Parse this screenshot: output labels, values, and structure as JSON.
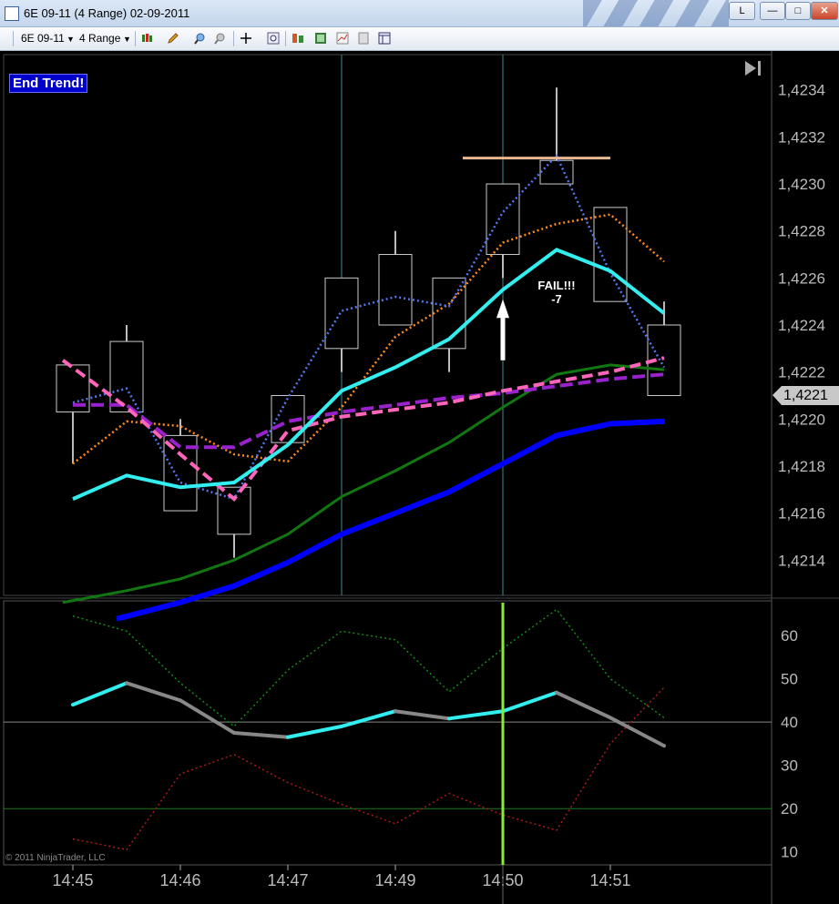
{
  "window": {
    "title": "6E 09-11 (4 Range)  02-09-2011",
    "buttons": {
      "l": "L",
      "minimize": "—",
      "maximize": "□",
      "close": "✕"
    }
  },
  "toolbar": {
    "instrument": "6E 09-11",
    "interval": "4 Range",
    "icons": [
      "candlestick-style-icon",
      "pencil-draw-icon",
      "zoom-in-icon",
      "zoom-out-icon",
      "crosshair-icon",
      "magnify-icon",
      "data-box-icon",
      "chart-trader-icon",
      "strategy-icon",
      "properties-icon",
      "template-icon"
    ]
  },
  "chart_labels": {
    "end_trend": "End Trend!",
    "fail_line1": "FAIL!!!",
    "fail_line2": "-7",
    "last_price": "1,4221",
    "copyright": "© 2011 NinjaTrader, LLC"
  },
  "colors": {
    "background": "#000000",
    "ema_fast": "#33eeee",
    "sma_blue": "#0000ff",
    "ema_green": "#117711",
    "dotted_orange": "#ff8c1a",
    "dotted_blue": "#5577ee",
    "dashed_purple": "#9922cc",
    "dashed_pink": "#ff66bb",
    "resistance": "#e8b890",
    "cursor_line": "#88ee33"
  },
  "chart_data": [
    {
      "type": "candlestick",
      "x_ticks": [
        "14:45",
        "14:46",
        "14:47",
        "14:49",
        "14:50",
        "14:51"
      ],
      "ylim": [
        1.42125,
        1.42355
      ],
      "y_ticks": [
        "1,4214",
        "1,4216",
        "1,4218",
        "1,4220",
        "1,4222",
        "1,4224",
        "1,4226",
        "1,4228",
        "1,4230",
        "1,4232",
        "1,4234"
      ],
      "candles": [
        {
          "o": 1.42203,
          "h": 1.42211,
          "l": 1.42181,
          "c": 1.42223
        },
        {
          "o": 1.42203,
          "h": 1.4224,
          "l": 1.42203,
          "c": 1.42233
        },
        {
          "o": 1.42193,
          "h": 1.422,
          "l": 1.42161,
          "c": 1.42161
        },
        {
          "o": 1.42171,
          "h": 1.42171,
          "l": 1.42141,
          "c": 1.42151
        },
        {
          "o": 1.4219,
          "h": 1.4221,
          "l": 1.4219,
          "c": 1.4221
        },
        {
          "o": 1.4223,
          "h": 1.4226,
          "l": 1.4222,
          "c": 1.4226
        },
        {
          "o": 1.4224,
          "h": 1.4228,
          "l": 1.4224,
          "c": 1.4227
        },
        {
          "o": 1.4223,
          "h": 1.4226,
          "l": 1.4222,
          "c": 1.4226
        },
        {
          "o": 1.4227,
          "h": 1.423,
          "l": 1.4226,
          "c": 1.423
        },
        {
          "o": 1.423,
          "h": 1.42341,
          "l": 1.423,
          "c": 1.4231
        },
        {
          "o": 1.4229,
          "h": 1.4229,
          "l": 1.4225,
          "c": 1.4225
        },
        {
          "o": 1.4224,
          "h": 1.4225,
          "l": 1.4221,
          "c": 1.4221
        }
      ],
      "series": [
        {
          "values": [
            1.42166,
            1.42176,
            1.42171,
            1.42173,
            1.42189,
            1.42212,
            1.42222,
            1.42234,
            1.42255,
            1.42272,
            1.42263,
            1.42245
          ]
        },
        {
          "values": [
            null,
            1.42127,
            1.42132,
            1.4214,
            1.42151,
            1.42167,
            1.42178,
            1.4219,
            1.42205,
            1.42219,
            1.42223,
            1.42221
          ]
        },
        {
          "values": [
            null,
            null,
            1.42122,
            1.42129,
            1.42139,
            1.42151,
            1.4216,
            1.42169,
            1.42181,
            1.42193,
            1.42198,
            1.42199
          ]
        },
        {
          "values": [
            1.42181,
            1.42199,
            1.42197,
            1.42185,
            1.42182,
            1.42205,
            1.42235,
            1.42249,
            1.42275,
            1.42283,
            1.42287,
            1.42267
          ]
        },
        {
          "values": [
            1.42207,
            1.42213,
            1.42173,
            1.42166,
            1.42209,
            1.42246,
            1.42252,
            1.42248,
            1.42288,
            1.42312,
            1.42262,
            1.42222
          ]
        },
        {
          "values": [
            1.42206,
            1.42206,
            1.42188,
            1.42188,
            1.42199,
            1.42203,
            1.42206,
            1.42209,
            1.42211,
            1.42214,
            1.42217,
            1.42219
          ]
        },
        {
          "values": [
            null,
            1.42205,
            1.42185,
            1.42166,
            1.42195,
            1.42201,
            1.42204,
            1.42207,
            1.42212,
            1.42216,
            1.4222,
            1.42226
          ]
        }
      ],
      "resistance": 1.42311,
      "vertical_lines_at_bar": [
        5,
        8
      ]
    },
    {
      "type": "line",
      "ylim": [
        7,
        68
      ],
      "y_ticks": [
        "10",
        "20",
        "30",
        "40",
        "50",
        "60"
      ],
      "levels": [
        20,
        40
      ],
      "series": [
        {
          "values": [
            44,
            49,
            45,
            37.5,
            36.5,
            39,
            42.5,
            40.8,
            42.5,
            46.8,
            41,
            34.5
          ]
        },
        {
          "values": [
            64.5,
            61,
            49,
            39,
            52,
            61,
            59,
            47,
            57,
            66,
            50,
            41
          ]
        },
        {
          "values": [
            13,
            10.5,
            28,
            32.5,
            26,
            21,
            16.5,
            23.5,
            18.5,
            15,
            35,
            48
          ]
        }
      ],
      "cursor_at_bar": 8
    }
  ]
}
